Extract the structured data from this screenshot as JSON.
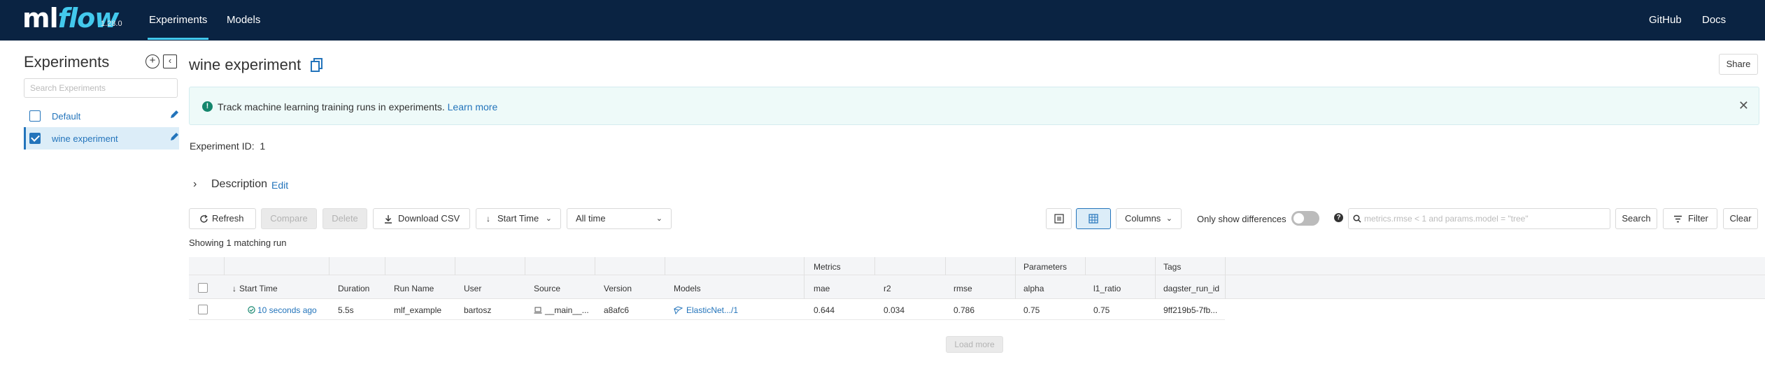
{
  "topbar": {
    "logo_prefix": "ml",
    "logo_suffix": "flow",
    "version": "1.28.0",
    "nav": [
      "Experiments",
      "Models"
    ],
    "links": [
      "GitHub",
      "Docs"
    ],
    "bg_color": "#0a2342",
    "accent": "#43c9ed"
  },
  "sidebar": {
    "title": "Experiments",
    "search_placeholder": "Search Experiments",
    "items": [
      {
        "label": "Default",
        "checked": false
      },
      {
        "label": "wine experiment",
        "checked": true
      }
    ]
  },
  "main": {
    "title": "wine experiment",
    "share_label": "Share",
    "banner": {
      "text": "Track machine learning training runs in experiments.",
      "link": "Learn more"
    },
    "experiment_id_label": "Experiment ID:",
    "experiment_id": "1",
    "description_label": "Description",
    "description_edit": "Edit",
    "toolbar": {
      "refresh": "Refresh",
      "compare": "Compare",
      "delete": "Delete",
      "download_csv": "Download CSV",
      "sort": "Start Time",
      "time_range": "All time",
      "columns": "Columns",
      "only_diff": "Only show differences",
      "search_placeholder": "metrics.rmse < 1 and params.model = \"tree\"",
      "search": "Search",
      "filter": "Filter",
      "clear": "Clear"
    },
    "showing": "Showing 1 matching run",
    "groups": {
      "metrics": "Metrics",
      "parameters": "Parameters",
      "tags": "Tags"
    },
    "columns": [
      "Start Time",
      "Duration",
      "Run Name",
      "User",
      "Source",
      "Version",
      "Models",
      "mae",
      "r2",
      "rmse",
      "alpha",
      "l1_ratio",
      "dagster_run_id"
    ],
    "rows": [
      {
        "start_time": "10 seconds ago",
        "duration": "5.5s",
        "run_name": "mlf_example",
        "user": "bartosz",
        "source": "__main__...",
        "version": "a8afc6",
        "models": "ElasticNet.../1",
        "mae": "0.644",
        "r2": "0.034",
        "rmse": "0.786",
        "alpha": "0.75",
        "l1_ratio": "0.75",
        "dagster_run_id": "9ff219b5-7fb..."
      }
    ],
    "load_more": "Load more"
  }
}
